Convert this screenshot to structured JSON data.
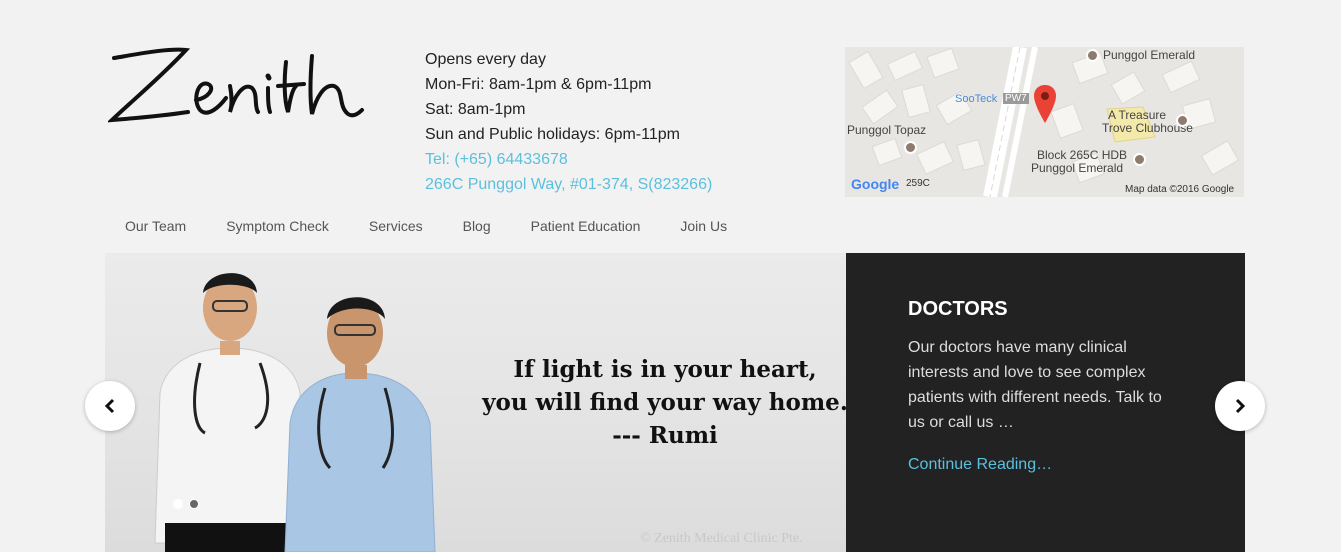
{
  "brand": {
    "logo_text": "Zenith"
  },
  "hours": {
    "line1": "Opens every day",
    "line2": "Mon-Fri: 8am-1pm & 6pm-11pm",
    "line3": "Sat: 8am-1pm",
    "line4": "Sun and Public holidays: 6pm-11pm",
    "phone": "Tel: (+65) 64433678",
    "address": "266C Punggol Way, #01-374, S(823266)"
  },
  "map": {
    "labels": {
      "punggol_emerald_top": "Punggol Emerald",
      "sooteck": "SooTeck",
      "pw7": "PW7",
      "treasure_1": "A Treasure",
      "treasure_2": "Trove Clubhouse",
      "punggol_topaz": "Punggol Topaz",
      "block_1": "Block 265C HDB",
      "block_2": "Punggol Emerald",
      "blk259": "259C",
      "google": "Google",
      "attribution": "Map data ©2016 Google"
    }
  },
  "nav": {
    "items": [
      "Our Team",
      "Symptom Check",
      "Services",
      "Blog",
      "Patient Education",
      "Join Us"
    ]
  },
  "slider": {
    "quote_line1": "If light is in your heart,",
    "quote_line2": "you will find your way home.",
    "quote_line3": "--- Rumi",
    "watermark": "© Zenith Medical Clinic Pte.",
    "prev_icon": "chevron-left-icon",
    "next_icon": "chevron-right-icon"
  },
  "panel": {
    "title": "DOCTORS",
    "body": "Our doctors have many clinical interests and love to see complex patients with different needs. Talk to us or call us …",
    "more": "Continue Reading…"
  },
  "colors": {
    "accent": "#5bc0de",
    "panel_bg": "#222222",
    "page_bg": "#f2f2f2"
  }
}
